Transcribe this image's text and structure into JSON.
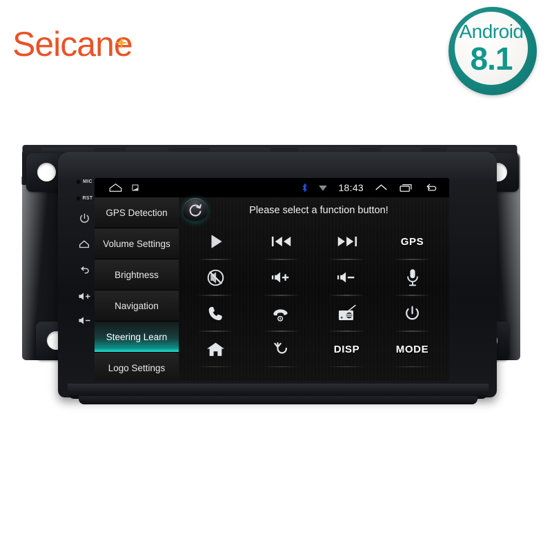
{
  "brand": {
    "name": "Seicane",
    "star_icon": "sparkle-icon",
    "color": "#ea5228",
    "star_color": "#f5a623"
  },
  "android_badge": {
    "word": "Android",
    "version": "8.1",
    "ring_color": "#16867f",
    "text_color": "#11968e"
  },
  "device": {
    "hardware_keys": [
      {
        "label": "MIC",
        "type": "hole"
      },
      {
        "label": "RST",
        "type": "hole"
      },
      {
        "label": "",
        "icon": "power-icon"
      },
      {
        "label": "",
        "icon": "home-icon"
      },
      {
        "label": "",
        "icon": "back-icon"
      },
      {
        "label": "",
        "icon": "volume-up-icon"
      },
      {
        "label": "",
        "icon": "volume-down-icon"
      }
    ]
  },
  "statusbar": {
    "left_icons": [
      "home-outline-icon",
      "notification-square-icon"
    ],
    "right_icons": [
      "bluetooth-icon",
      "wifi-icon"
    ],
    "clock": "18:43",
    "nav_icons": [
      "chevron-up-icon",
      "recents-icon",
      "back-icon"
    ],
    "bluetooth_color": "#2b5cff"
  },
  "sidebar": {
    "items": [
      {
        "label": "GPS Detection",
        "active": false
      },
      {
        "label": "Volume Settings",
        "active": false
      },
      {
        "label": "Brightness",
        "active": false
      },
      {
        "label": "Navigation",
        "active": false
      },
      {
        "label": "Steering Learn",
        "active": true
      },
      {
        "label": "Logo Settings",
        "active": false
      }
    ],
    "active_color": "#13c6b7"
  },
  "panel": {
    "refresh_icon": "refresh-icon",
    "title": "Please select a function button!",
    "buttons": [
      {
        "name": "play-button",
        "icon": "play-icon",
        "label": ""
      },
      {
        "name": "previous-button",
        "icon": "previous-track-icon",
        "label": ""
      },
      {
        "name": "next-button",
        "icon": "next-track-icon",
        "label": ""
      },
      {
        "name": "gps-button",
        "icon": "",
        "label": "GPS"
      },
      {
        "name": "mute-button",
        "icon": "mute-icon",
        "label": ""
      },
      {
        "name": "volume-up-button",
        "icon": "volume-up-icon",
        "label": ""
      },
      {
        "name": "volume-down-button",
        "icon": "volume-down-icon",
        "label": ""
      },
      {
        "name": "voice-button",
        "icon": "microphone-icon",
        "label": ""
      },
      {
        "name": "call-button",
        "icon": "phone-call-icon",
        "label": ""
      },
      {
        "name": "hangup-button",
        "icon": "phone-hangup-icon",
        "label": ""
      },
      {
        "name": "radio-button",
        "icon": "radio-icon",
        "label": ""
      },
      {
        "name": "power-button",
        "icon": "power-icon",
        "label": ""
      },
      {
        "name": "home-button",
        "icon": "home-filled-icon",
        "label": ""
      },
      {
        "name": "return-button",
        "icon": "return-arrow-icon",
        "label": ""
      },
      {
        "name": "disp-button",
        "icon": "",
        "label": "DISP"
      },
      {
        "name": "mode-button",
        "icon": "",
        "label": "MODE"
      }
    ]
  }
}
